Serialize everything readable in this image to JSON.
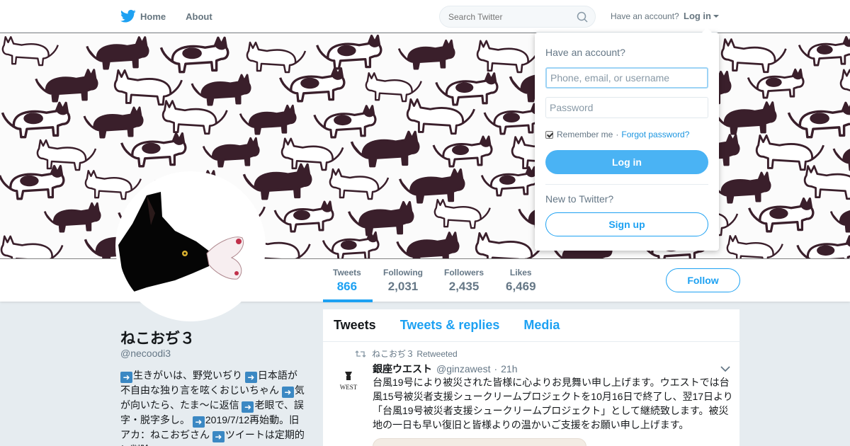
{
  "nav": {
    "home_label": "Home",
    "about_label": "About",
    "search_placeholder": "Search Twitter",
    "have_account": "Have an account?",
    "login_label": "Log in"
  },
  "profile": {
    "name": "ねこおぢ３",
    "handle": "@necoodi3",
    "bio_segments": [
      "生きがいは、野党いぢり",
      "日本語が不自由な独り言を呟くおじいちゃん",
      "気が向いたら、たま～に返信",
      "老眼で、誤字・脱字多し。",
      "2019/7/12再始動。旧アカ：ねこおぢさん",
      "ツイートは定期的に削除。"
    ]
  },
  "stats": [
    {
      "label": "Tweets",
      "value": "866",
      "active": true
    },
    {
      "label": "Following",
      "value": "2,031",
      "active": false
    },
    {
      "label": "Followers",
      "value": "2,435",
      "active": false
    },
    {
      "label": "Likes",
      "value": "6,469",
      "active": false
    }
  ],
  "follow_label": "Follow",
  "timeline": {
    "tabs": [
      "Tweets",
      "Tweets & replies",
      "Media"
    ],
    "tweet": {
      "retweeted_by": "ねこおぢ３ Retweeted",
      "name": "銀座ウエスト",
      "handle": "@ginzawest",
      "time": "21h",
      "text": "台風19号により被災された皆様に心よりお見舞い申し上げます。ウエストでは台風15号被災者支援シュークリームプロジェクトを10月16日で終了し、翌17日より「台風19号被災者支援シュークリームプロジェクト」として継続致します。被災地の一日も早い復旧と皆様よりの温かいご支援をお願い申し上げます。",
      "avatar_text": "WEST"
    }
  },
  "login_dropdown": {
    "title": "Have an account?",
    "username_placeholder": "Phone, email, or username",
    "password_placeholder": "Password",
    "remember_label": "Remember me",
    "separator": "·",
    "forgot_label": "Forgot password?",
    "login_button": "Log in",
    "new_label": "New to Twitter?",
    "signup_button": "Sign up"
  },
  "colors": {
    "accent": "#1da1f2",
    "login_button": "#4ab3f4",
    "cat_dark": "#3a1f2b"
  }
}
